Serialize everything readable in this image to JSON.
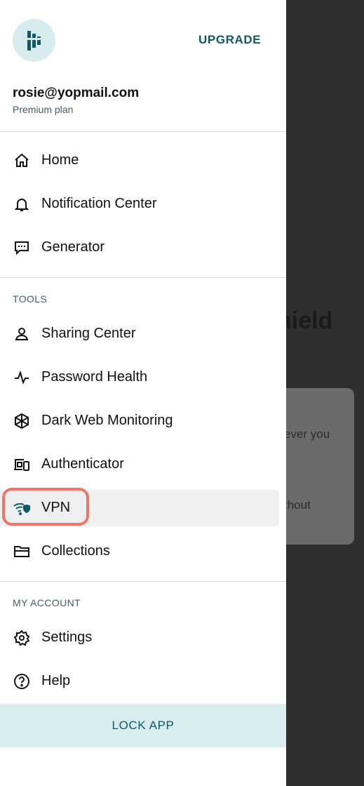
{
  "background": {
    "title_fragment": "hield",
    "text1": "ever you",
    "text2": "thout"
  },
  "header": {
    "upgrade_label": "UPGRADE",
    "email": "rosie@yopmail.com",
    "plan": "Premium plan"
  },
  "nav": {
    "main": [
      {
        "label": "Home",
        "icon": "home-icon"
      },
      {
        "label": "Notification Center",
        "icon": "bell-icon"
      },
      {
        "label": "Generator",
        "icon": "generator-icon"
      }
    ],
    "tools_title": "TOOLS",
    "tools": [
      {
        "label": "Sharing Center",
        "icon": "sharing-icon"
      },
      {
        "label": "Password Health",
        "icon": "pulse-icon"
      },
      {
        "label": "Dark Web Monitoring",
        "icon": "dark-web-icon"
      },
      {
        "label": "Authenticator",
        "icon": "authenticator-icon"
      },
      {
        "label": "VPN",
        "icon": "vpn-icon",
        "active": true
      },
      {
        "label": "Collections",
        "icon": "folder-icon"
      }
    ],
    "account_title": "MY ACCOUNT",
    "account": [
      {
        "label": "Settings",
        "icon": "gear-icon"
      },
      {
        "label": "Help",
        "icon": "help-icon"
      }
    ]
  },
  "footer": {
    "lock_label": "LOCK APP"
  },
  "colors": {
    "accent": "#0e5966",
    "highlight_ring": "#f07664",
    "lock_bg": "#d9edf0"
  }
}
